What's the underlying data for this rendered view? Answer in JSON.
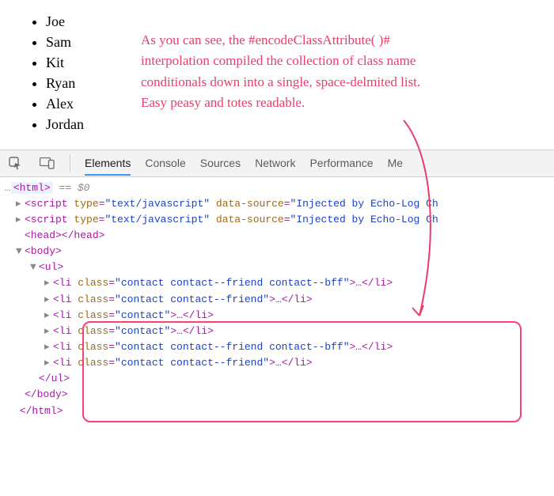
{
  "list": [
    "Joe",
    "Sam",
    "Kit",
    "Ryan",
    "Alex",
    "Jordan"
  ],
  "annotation": "As you can see, the #encodeClassAttribute( )#\ninterpolation compiled the collection of class name\nconditionals down into a single, space-delmited list.\nEasy peasy and totes readable.",
  "devtools": {
    "tabs": [
      "Elements",
      "Console",
      "Sources",
      "Network",
      "Performance",
      "Me"
    ],
    "activeTab": 0,
    "html_open": "<html>",
    "eq": "== $0",
    "script_open": "<script",
    "script_close": ">",
    "type_attr": "type",
    "type_val": "\"text/javascript\"",
    "data_src_attr": "data-source",
    "data_src_val": "\"Injected by Echo-Log Ch",
    "head": "<head></head>",
    "body": "<body>",
    "ul": "<ul>",
    "li_open": "<li",
    "li_close": "</li>",
    "class_attr": "class",
    "li_classes": [
      "\"contact contact--friend contact--bff\"",
      "\"contact contact--friend\"",
      "\"contact\"",
      "\"contact\"",
      "\"contact contact--friend contact--bff\"",
      "\"contact contact--friend\""
    ],
    "ul_close": "</ul>",
    "body_close": "</body>",
    "html_close": "</html>",
    "equals": "=",
    "gt": ">",
    "quote_gt": ">…"
  }
}
